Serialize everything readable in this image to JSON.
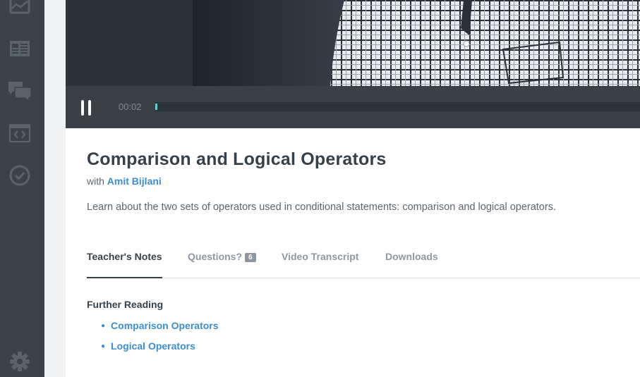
{
  "sidebar": {
    "icons": [
      "map-icon",
      "book-icon",
      "chat-icon",
      "code-window-icon",
      "check-circle-icon",
      "gear-icon"
    ]
  },
  "player": {
    "elapsed": "00:02",
    "progress_fraction": 0.005
  },
  "video": {
    "title": "Comparison and Logical Operators",
    "with_label": "with",
    "instructor": "Amit Bijlani",
    "description": "Learn about the two sets of operators used in conditional statements: comparison and logical operators."
  },
  "tabs": [
    {
      "label": "Teacher's Notes",
      "active": true
    },
    {
      "label": "Questions?",
      "badge": "6",
      "active": false
    },
    {
      "label": "Video Transcript",
      "active": false
    },
    {
      "label": "Downloads",
      "active": false
    }
  ],
  "notes": {
    "heading": "Further Reading",
    "links": [
      "Comparison Operators",
      "Logical Operators"
    ]
  },
  "colors": {
    "sidebar": "#3c4248",
    "link": "#3c8fcc",
    "progress": "#5fcfc7",
    "title": "#384047"
  }
}
